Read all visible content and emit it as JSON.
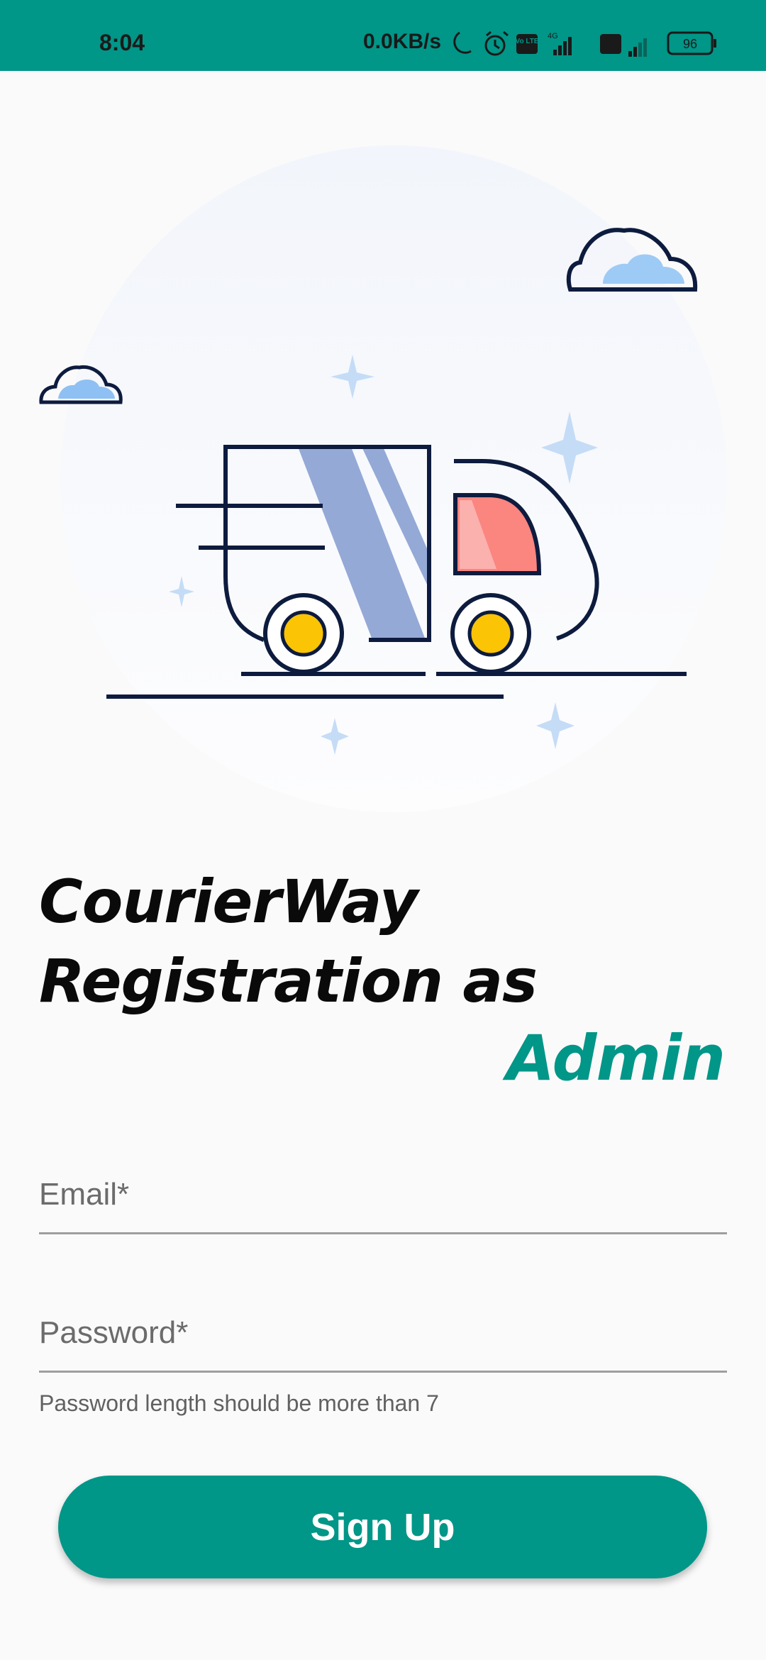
{
  "status_bar": {
    "time": "8:04",
    "network_speed": "0.0KB/s",
    "battery": "96",
    "network_type": "4G",
    "volte_label": "Vo LTE",
    "background_color": "#009688"
  },
  "hero": {
    "description_icons": [
      "delivery-truck-icon",
      "cloud-icon",
      "sparkle-icon"
    ]
  },
  "title": {
    "line1": "CourierWay",
    "line2": "Registration as",
    "role": "Admin",
    "role_color": "#009688"
  },
  "form": {
    "email_placeholder": "Email*",
    "email_value": "",
    "password_placeholder": "Password*",
    "password_value": "",
    "password_helper": "Password length should be more than 7"
  },
  "actions": {
    "signup_label": "Sign Up",
    "accent_color": "#009688"
  }
}
